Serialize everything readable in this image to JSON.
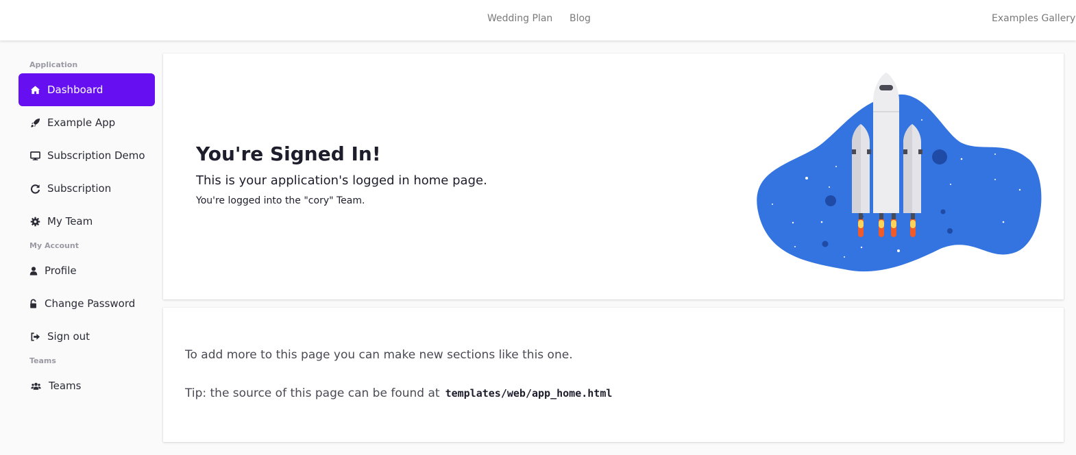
{
  "topnav": {
    "links": [
      {
        "label": "Wedding Plan"
      },
      {
        "label": "Blog"
      }
    ],
    "right_link": "Examples Gallery"
  },
  "sidebar": {
    "sections": [
      {
        "label": "Application"
      },
      {
        "label": "My Account"
      },
      {
        "label": "Teams"
      }
    ],
    "items": [
      {
        "label": "Dashboard",
        "icon": "home-icon",
        "active": true
      },
      {
        "label": "Example App",
        "icon": "rocket-icon"
      },
      {
        "label": "Subscription Demo",
        "icon": "desktop-icon"
      },
      {
        "label": "Subscription",
        "icon": "refresh-icon"
      },
      {
        "label": "My Team",
        "icon": "gear-icon"
      },
      {
        "label": "Profile",
        "icon": "user-icon"
      },
      {
        "label": "Change Password",
        "icon": "unlock-icon"
      },
      {
        "label": "Sign out",
        "icon": "sign-out-icon"
      },
      {
        "label": "Teams",
        "icon": "users-icon"
      }
    ]
  },
  "hero": {
    "title": "You're Signed In!",
    "subtitle": "This is your application's logged in home page.",
    "team_text": "You're logged into the \"cory\" Team.",
    "illustration": "rocket-launch-illustration"
  },
  "section": {
    "text": "To add more to this page you can make new sections like this one.",
    "tip_text": "Tip: the source of this page can be found at",
    "tip_path": "templates/web/app_home.html"
  },
  "colors": {
    "accent": "#6610f2",
    "blob": "#3474e0"
  }
}
